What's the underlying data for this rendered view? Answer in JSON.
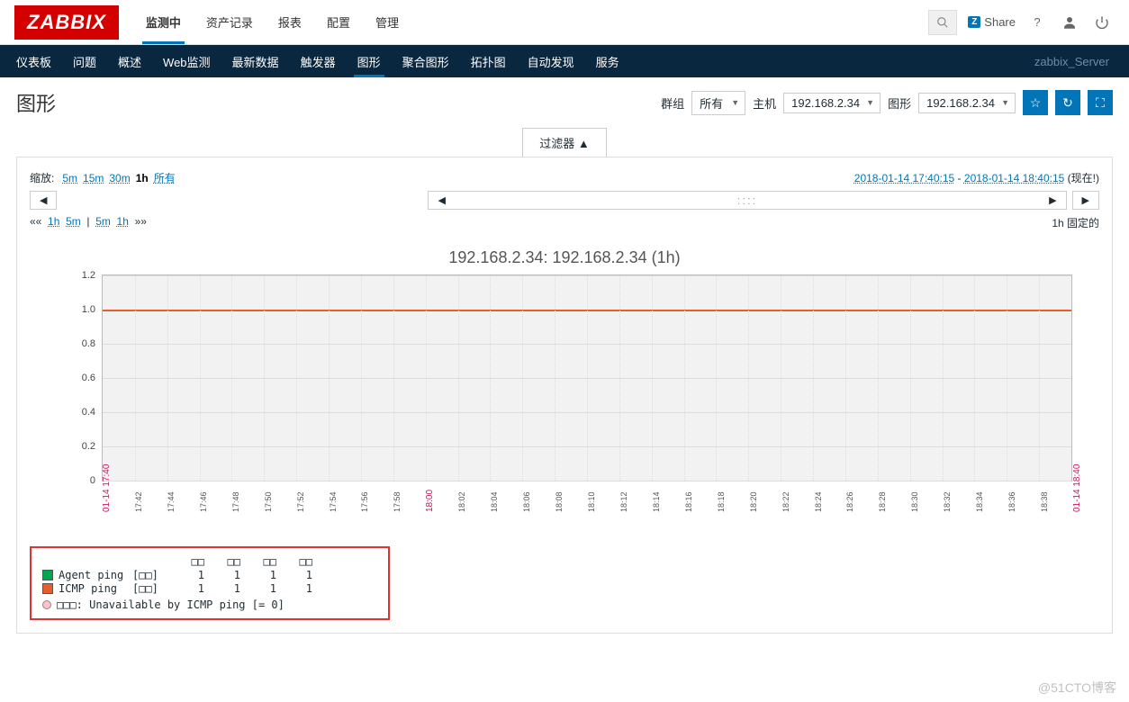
{
  "logo": "ZABBIX",
  "main_nav": [
    "监测中",
    "资产记录",
    "报表",
    "配置",
    "管理"
  ],
  "main_nav_active": 0,
  "share_label": "Share",
  "sub_nav": [
    "仪表板",
    "问题",
    "概述",
    "Web监测",
    "最新数据",
    "触发器",
    "图形",
    "聚合图形",
    "拓扑图",
    "自动发现",
    "服务"
  ],
  "sub_nav_active": 6,
  "server_name": "zabbix_Server",
  "page_title": "图形",
  "filters": {
    "group_label": "群组",
    "group_value": "所有",
    "host_label": "主机",
    "host_value": "192.168.2.34",
    "graph_label": "图形",
    "graph_value": "192.168.2.34"
  },
  "filter_tab": "过滤器 ▲",
  "zoom": {
    "label": "缩放:",
    "options": [
      "5m",
      "15m",
      "30m",
      "1h",
      "所有"
    ],
    "active": "1h"
  },
  "time_range": {
    "from": "2018-01-14 17:40:15",
    "to": "2018-01-14 18:40:15",
    "now": "(现在!)"
  },
  "step_links": {
    "ll": "««",
    "l1": "1h",
    "l2": "5m",
    "sep": "|",
    "r1": "5m",
    "r2": "1h",
    "rr": "»»"
  },
  "fixed_label": "1h  固定的",
  "chart_data": {
    "type": "line",
    "title": "192.168.2.34: 192.168.2.34 (1h)",
    "ylim": [
      0,
      1.2
    ],
    "y_ticks": [
      "0",
      "0.2",
      "0.4",
      "0.6",
      "0.8",
      "1.0",
      "1.2"
    ],
    "x_start": "01-14 17:40",
    "x_end": "01-14 18:40",
    "x_ticks": [
      "17:42",
      "17:44",
      "17:46",
      "17:48",
      "17:50",
      "17:52",
      "17:54",
      "17:56",
      "17:58",
      "18:00",
      "18:02",
      "18:04",
      "18:06",
      "18:08",
      "18:10",
      "18:12",
      "18:14",
      "18:16",
      "18:18",
      "18:20",
      "18:22",
      "18:24",
      "18:26",
      "18:28",
      "18:30",
      "18:32",
      "18:34",
      "18:36",
      "18:38"
    ],
    "series": [
      {
        "name": "Agent ping",
        "color": "#00a651",
        "stat": "[□□]",
        "values": [
          1,
          1,
          1,
          1
        ]
      },
      {
        "name": "ICMP ping",
        "color": "#e85d2c",
        "stat": "[□□]",
        "values": [
          1,
          1,
          1,
          1
        ]
      }
    ],
    "legend_headers": [
      "□□",
      "□□",
      "□□",
      "□□"
    ],
    "trigger": "□□□: Unavailable by ICMP ping    [= 0]"
  },
  "watermark": "@51CTO博客"
}
